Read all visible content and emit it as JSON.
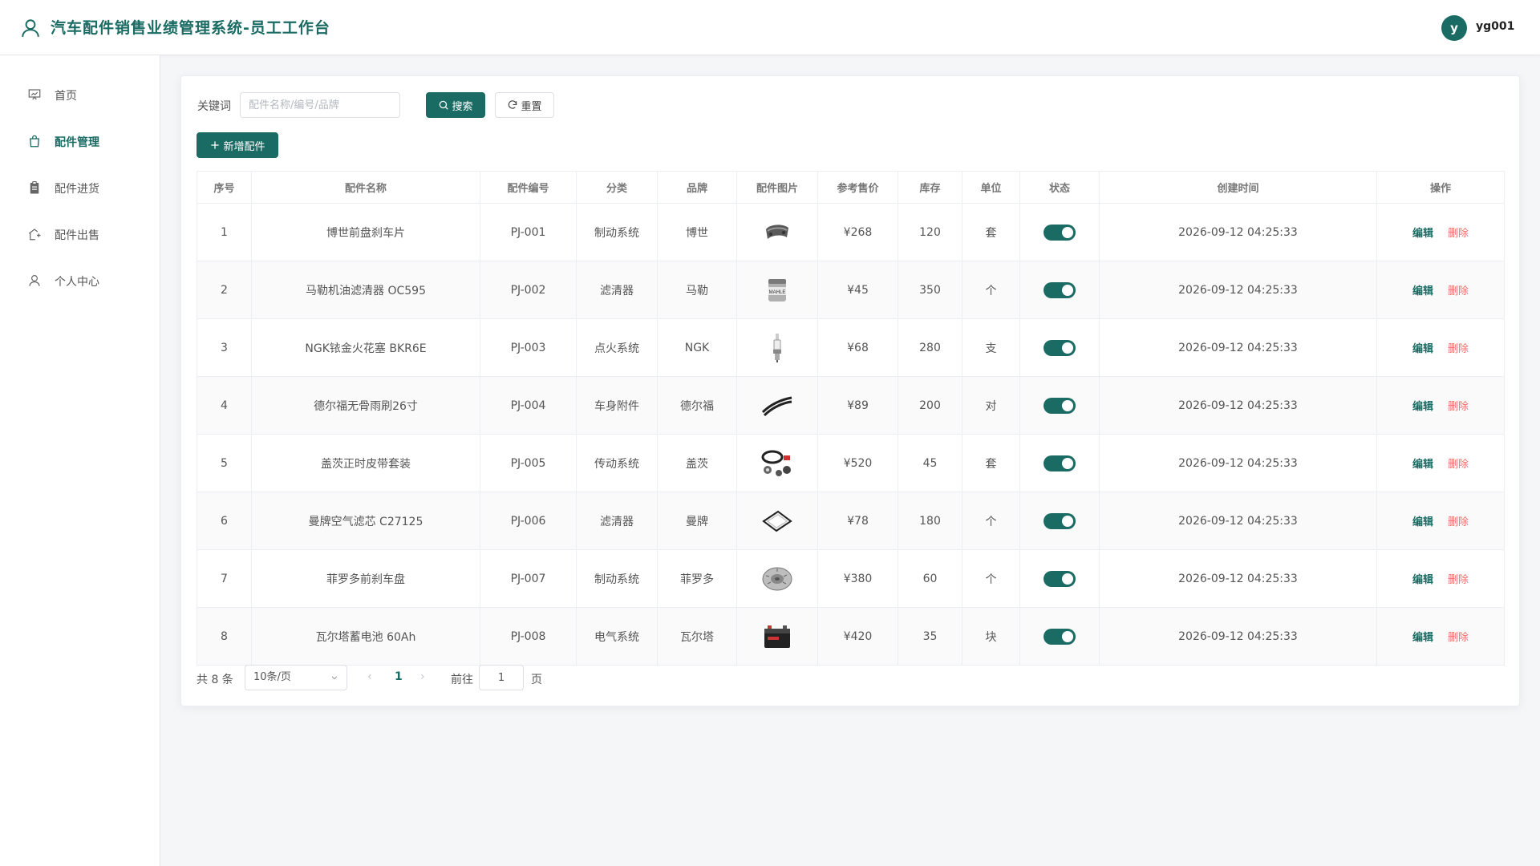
{
  "app": {
    "title": "汽车配件销售业绩管理系统-员工工作台",
    "user": {
      "avatar_letter": "y",
      "name": "yg001"
    },
    "accent_color": "#1a6b63",
    "danger_color": "#f56c6c"
  },
  "sidebar": {
    "items": [
      {
        "label": "首页",
        "icon": "presentation-icon",
        "active": false
      },
      {
        "label": "配件管理",
        "icon": "shopping-bag-icon",
        "active": true
      },
      {
        "label": "配件进货",
        "icon": "clipboard-icon",
        "active": false
      },
      {
        "label": "配件出售",
        "icon": "house-export-icon",
        "active": false
      },
      {
        "label": "个人中心",
        "icon": "user-icon",
        "active": false
      }
    ]
  },
  "filter": {
    "keyword_label": "关键词",
    "keyword_placeholder": "配件名称/编号/品牌",
    "keyword_value": "",
    "search_label": "搜索",
    "reset_label": "重置",
    "add_label": "新增配件"
  },
  "table": {
    "columns": [
      "序号",
      "配件名称",
      "配件编号",
      "分类",
      "品牌",
      "配件图片",
      "参考售价",
      "库存",
      "单位",
      "状态",
      "创建时间",
      "操作"
    ],
    "edit_label": "编辑",
    "delete_label": "删除",
    "rows": [
      {
        "index": "1",
        "name": "博世前盘刹车片",
        "code": "PJ-001",
        "category": "制动系统",
        "brand": "博世",
        "image": "brake-pad-icon",
        "price": "¥268",
        "stock": "120",
        "unit": "套",
        "status": true,
        "created": "2026-09-12 04:25:33"
      },
      {
        "index": "2",
        "name": "马勒机油滤清器 OC595",
        "code": "PJ-002",
        "category": "滤清器",
        "brand": "马勒",
        "image": "oil-filter-icon",
        "price": "¥45",
        "stock": "350",
        "unit": "个",
        "status": true,
        "created": "2026-09-12 04:25:33"
      },
      {
        "index": "3",
        "name": "NGK铱金火花塞 BKR6E",
        "code": "PJ-003",
        "category": "点火系统",
        "brand": "NGK",
        "image": "spark-plug-icon",
        "price": "¥68",
        "stock": "280",
        "unit": "支",
        "status": true,
        "created": "2026-09-12 04:25:33"
      },
      {
        "index": "4",
        "name": "德尔福无骨雨刷26寸",
        "code": "PJ-004",
        "category": "车身附件",
        "brand": "德尔福",
        "image": "wiper-blade-icon",
        "price": "¥89",
        "stock": "200",
        "unit": "对",
        "status": true,
        "created": "2026-09-12 04:25:33"
      },
      {
        "index": "5",
        "name": "盖茨正时皮带套装",
        "code": "PJ-005",
        "category": "传动系统",
        "brand": "盖茨",
        "image": "timing-belt-kit-icon",
        "price": "¥520",
        "stock": "45",
        "unit": "套",
        "status": true,
        "created": "2026-09-12 04:25:33"
      },
      {
        "index": "6",
        "name": "曼牌空气滤芯 C27125",
        "code": "PJ-006",
        "category": "滤清器",
        "brand": "曼牌",
        "image": "air-filter-icon",
        "price": "¥78",
        "stock": "180",
        "unit": "个",
        "status": true,
        "created": "2026-09-12 04:25:33"
      },
      {
        "index": "7",
        "name": "菲罗多前刹车盘",
        "code": "PJ-007",
        "category": "制动系统",
        "brand": "菲罗多",
        "image": "brake-disc-icon",
        "price": "¥380",
        "stock": "60",
        "unit": "个",
        "status": true,
        "created": "2026-09-12 04:25:33"
      },
      {
        "index": "8",
        "name": "瓦尔塔蓄电池 60Ah",
        "code": "PJ-008",
        "category": "电气系统",
        "brand": "瓦尔塔",
        "image": "car-battery-icon",
        "price": "¥420",
        "stock": "35",
        "unit": "块",
        "status": true,
        "created": "2026-09-12 04:25:33"
      }
    ]
  },
  "pagination": {
    "total_label": "共 8 条",
    "page_size_label": "10条/页",
    "current_page": "1",
    "goto_label": "前往",
    "goto_value": "1",
    "page_suffix": "页"
  }
}
